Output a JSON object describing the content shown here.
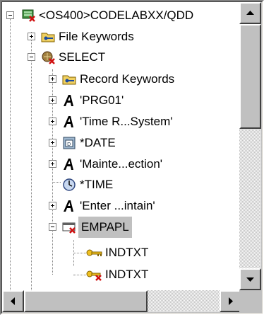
{
  "tree": {
    "items": [
      {
        "label": "<OS400>CODELABXX/QDD",
        "icon": "database-table-icon",
        "expanded": true
      },
      {
        "label": "File Keywords",
        "icon": "key-folder-icon",
        "expanded": false
      },
      {
        "label": "SELECT",
        "icon": "select-format-icon",
        "expanded": true
      },
      {
        "label": "Record Keywords",
        "icon": "key-folder-icon",
        "expanded": false
      },
      {
        "label": "'PRG01'",
        "icon": "constant-text-icon",
        "expanded": false
      },
      {
        "label": "'Time R...System'",
        "icon": "constant-text-icon",
        "expanded": false
      },
      {
        "label": "*DATE",
        "icon": "date-icon",
        "expanded": false
      },
      {
        "label": "'Mainte...ection'",
        "icon": "constant-text-icon",
        "expanded": false
      },
      {
        "label": "*TIME",
        "icon": "clock-icon",
        "expanded": false
      },
      {
        "label": "'Enter ...intain'",
        "icon": "constant-text-icon",
        "expanded": false
      },
      {
        "label": "EMPAPL",
        "icon": "subfile-icon",
        "expanded": true,
        "selected": true
      },
      {
        "label": "INDTXT",
        "icon": "key-icon"
      },
      {
        "label": "INDTXT",
        "icon": "key-error-icon"
      }
    ]
  },
  "colors": {
    "selection": "#c0c0c0",
    "window_face": "#c0c0c0"
  }
}
